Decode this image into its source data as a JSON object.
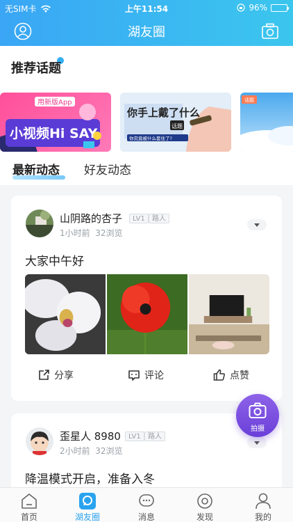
{
  "status_bar": {
    "carrier": "无SIM卡",
    "time": "上午11:54",
    "battery": "96%"
  },
  "header": {
    "title": "湖友圈"
  },
  "recommended": {
    "title": "推荐话题"
  },
  "banners": [
    {
      "tag": "用新版App",
      "text": "小视频Hi SAY"
    },
    {
      "text": "你手上戴了什么",
      "tag": "话题",
      "sub": "你究竟被什么套住了?"
    },
    {
      "tag": "话题"
    }
  ],
  "feed_tabs": [
    {
      "label": "最新动态"
    },
    {
      "label": "好友动态"
    }
  ],
  "posts": [
    {
      "username": "山阴路的杏子",
      "level": "LV1",
      "role": "路人",
      "time": "1小时前",
      "views": "32浏览",
      "text": "大家中午好",
      "photos": [
        "orchid",
        "poppy",
        "living-room"
      ]
    },
    {
      "username": "歪星人 8980",
      "level": "LV1",
      "role": "路人",
      "time": "2小时前",
      "views": "32浏览",
      "text": "降温模式开启，准备入冬"
    }
  ],
  "actions": {
    "share": "分享",
    "comment": "评论",
    "like": "点赞"
  },
  "fab": {
    "label": "拍摄"
  },
  "tabbar": [
    {
      "label": "首页",
      "icon": "home-icon"
    },
    {
      "label": "湖友圈",
      "icon": "circle-chat-icon",
      "active": true
    },
    {
      "label": "消息",
      "icon": "message-icon"
    },
    {
      "label": "发现",
      "icon": "discover-icon"
    },
    {
      "label": "我的",
      "icon": "profile-icon"
    }
  ],
  "colors": {
    "accent": "#2aa3ef",
    "fab": "#7a4fe0"
  }
}
